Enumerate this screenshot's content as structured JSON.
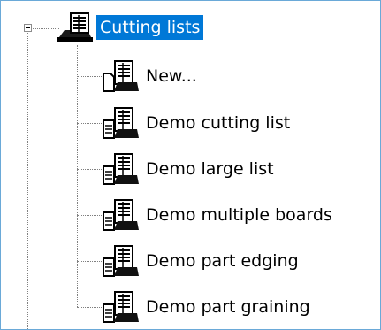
{
  "tree": {
    "root": {
      "label": "Cutting lists",
      "expander_icon": "minus-box-icon",
      "icon": "cutting-list-folder-icon",
      "selected": true,
      "selection_color": "#0078d7"
    },
    "children": [
      {
        "label": "New...",
        "icon": "new-document-icon"
      },
      {
        "label": "Demo cutting list",
        "icon": "cutting-list-icon"
      },
      {
        "label": "Demo large list",
        "icon": "cutting-list-icon"
      },
      {
        "label": "Demo multiple boards",
        "icon": "cutting-list-icon"
      },
      {
        "label": "Demo part edging",
        "icon": "cutting-list-icon"
      },
      {
        "label": "Demo part graining",
        "icon": "cutting-list-icon"
      }
    ]
  },
  "colors": {
    "frame_border": "#6aa9d8",
    "tree_line": "#808080"
  }
}
